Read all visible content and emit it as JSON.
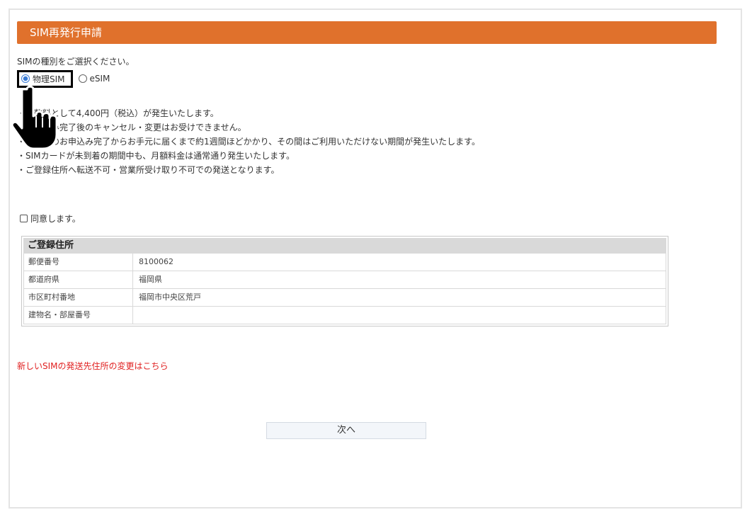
{
  "header": {
    "title": "SIM再発行申請"
  },
  "sim_type": {
    "prompt": "SIMの種別をご選択ください。",
    "options": [
      {
        "label": "物理SIM",
        "checked": true
      },
      {
        "label": "eSIM",
        "checked": false
      }
    ]
  },
  "notes": [
    "・手数料として4,400円（税込）が発生いたします。",
    "・お申込み完了後のキャンセル・変更はお受けできません。",
    "・再発行のお申込み完了からお手元に届くまで約1週間ほどかかり、その間はご利用いただけない期間が発生いたします。",
    "・SIMカードが未到着の期間中も、月額料金は通常通り発生いたします。",
    "・ご登録住所へ転送不可・営業所受け取り不可での発送となります。"
  ],
  "agree": {
    "label": "同意します。",
    "checked": false
  },
  "address": {
    "heading": "ご登録住所",
    "rows": [
      {
        "label": "郵便番号",
        "value": "8100062"
      },
      {
        "label": "都道府県",
        "value": "福岡県"
      },
      {
        "label": "市区町村番地",
        "value": "福岡市中央区荒戸"
      },
      {
        "label": "建物名・部屋番号",
        "value": ""
      }
    ]
  },
  "change_link": "新しいSIMの発送先住所の変更はこちら",
  "next_button": "次へ",
  "colors": {
    "title_bar": "#e0712c",
    "link": "#e02020",
    "radio_selected": "#3a7bd5"
  },
  "icons": {
    "cursor": "pointing-hand-icon"
  }
}
